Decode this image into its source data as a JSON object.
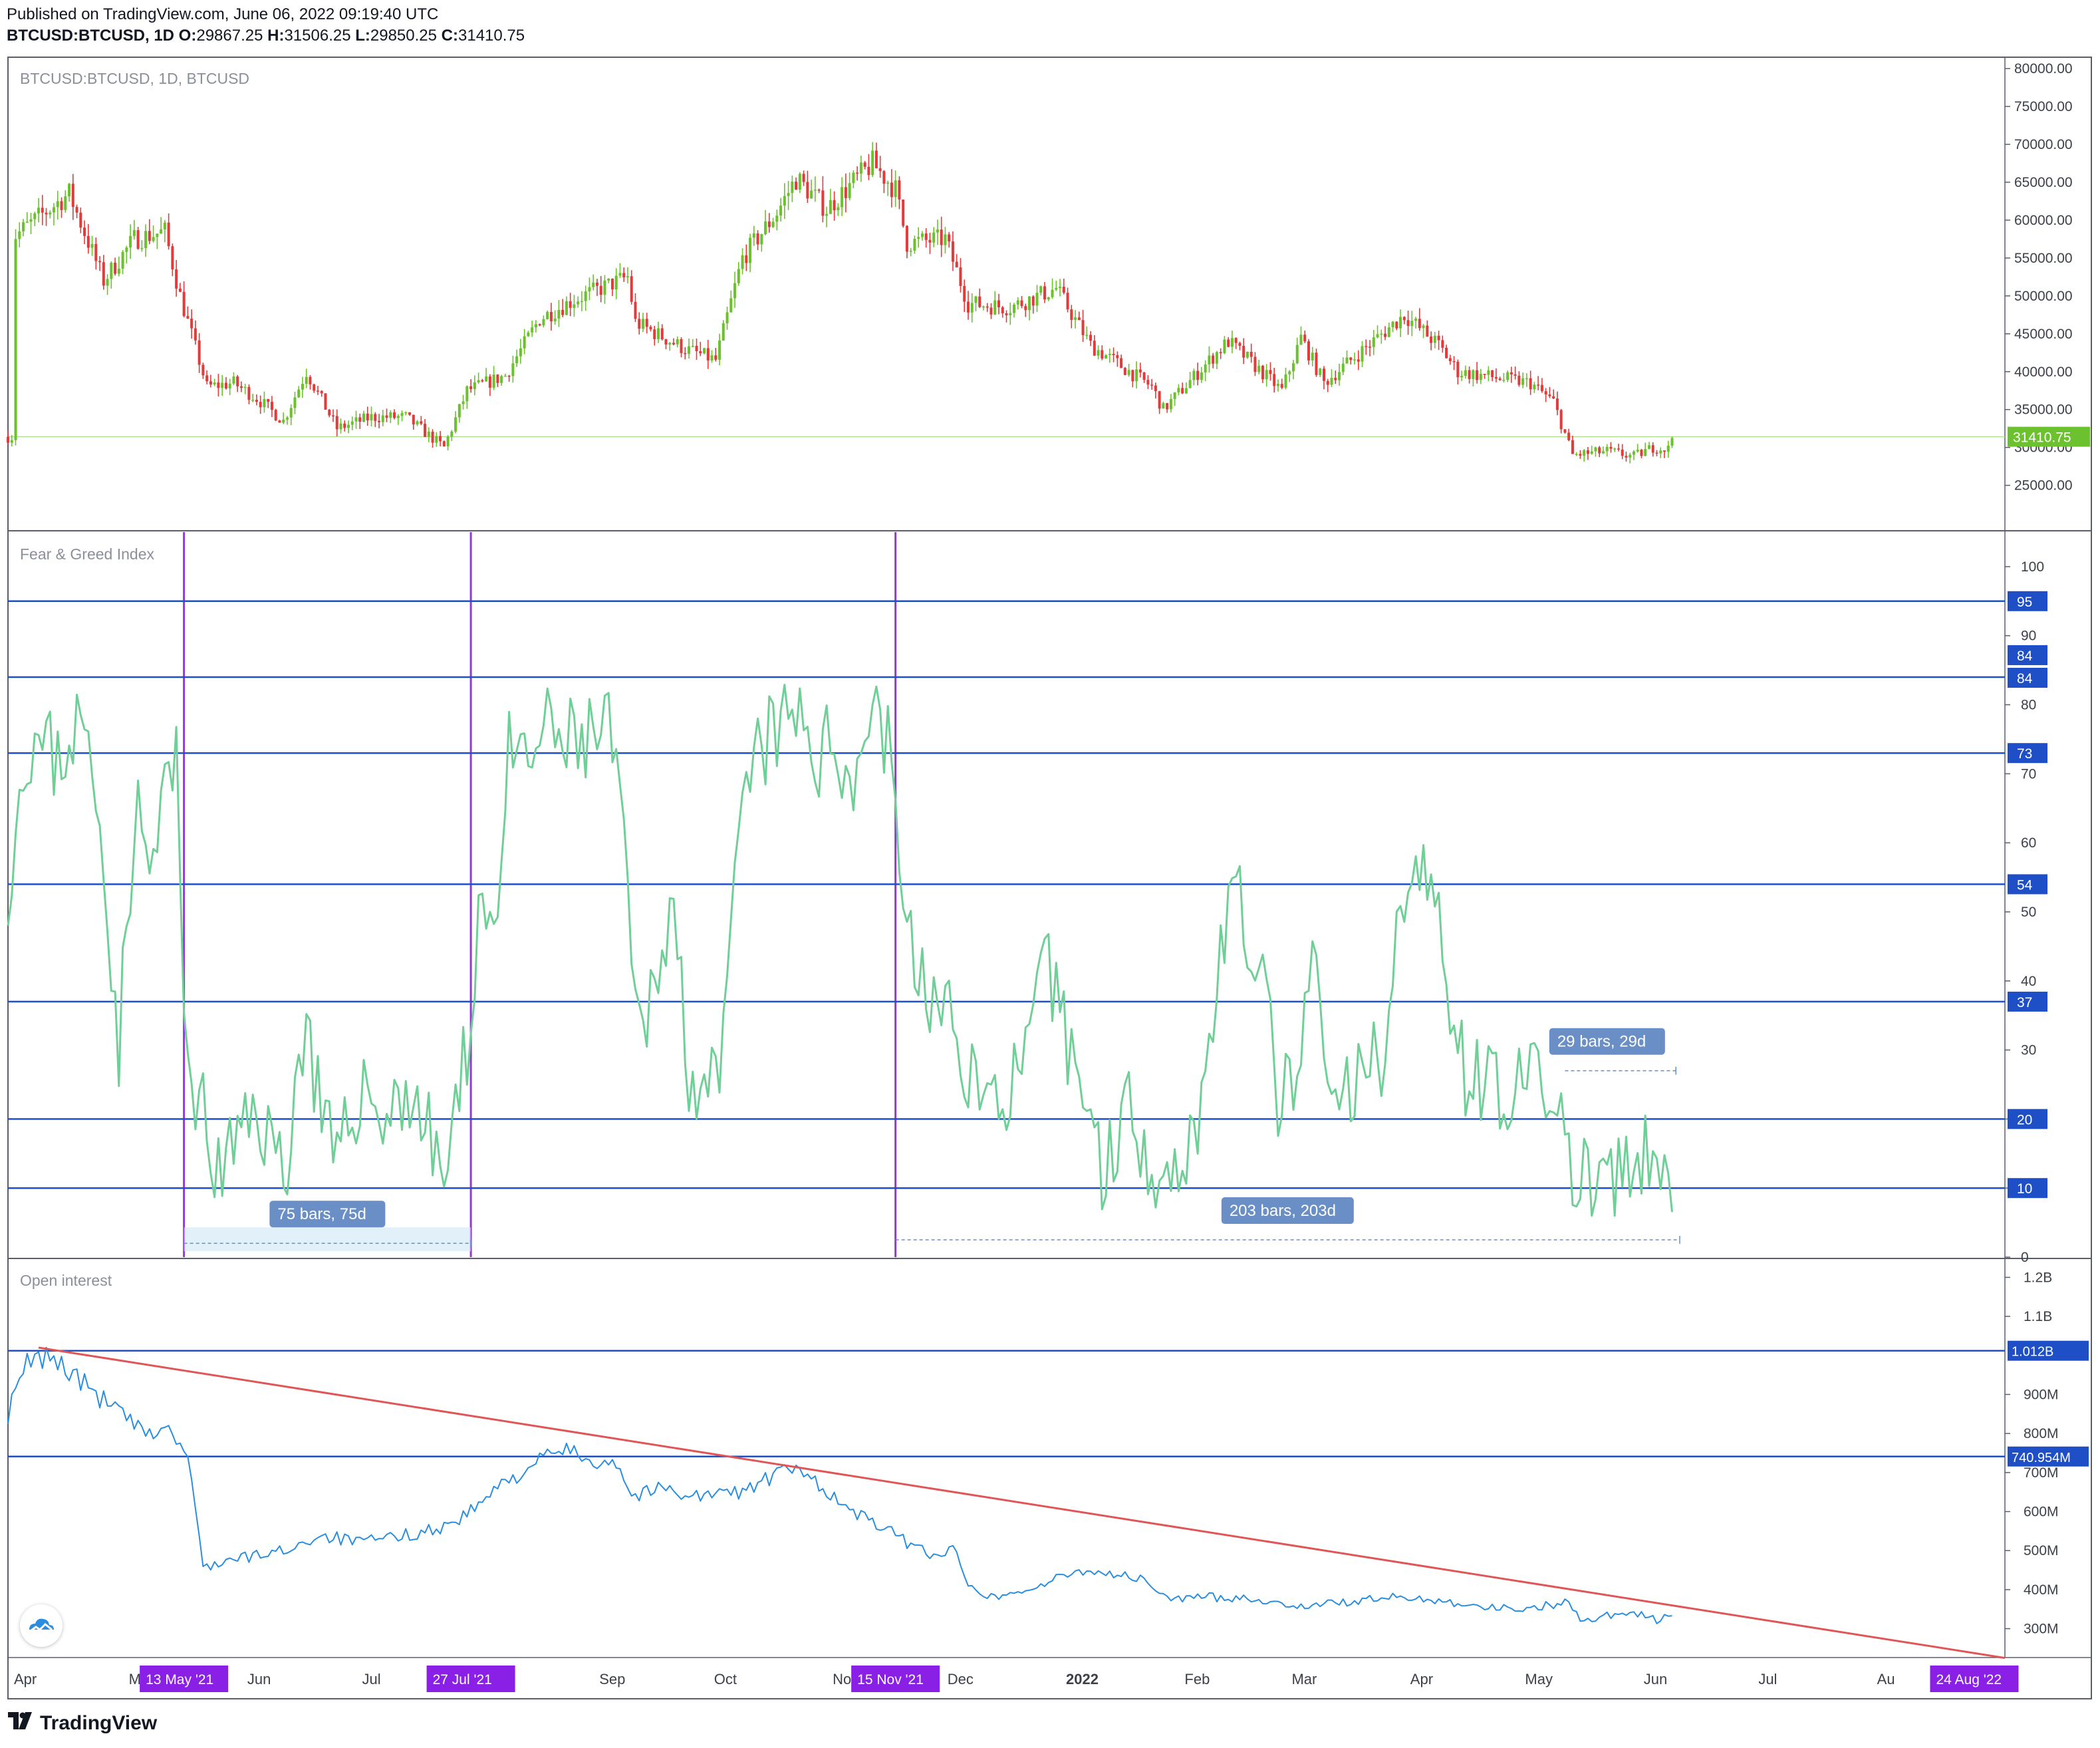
{
  "header": {
    "published": "Published on TradingView.com, June 06, 2022 09:19:40 UTC",
    "symbol": "BTCUSD:BTCUSD, 1D",
    "o_label": "O:",
    "o_value": "29867.25",
    "h_label": "H:",
    "h_value": "31506.25",
    "l_label": "L:",
    "l_value": "29850.25",
    "c_label": "C:",
    "c_value": "31410.75"
  },
  "brand": {
    "name": "TradingView",
    "logo_icon": "tradingview-logo-icon"
  },
  "colors": {
    "up": "#6cc22e",
    "down": "#e03c3c",
    "fng_line": "#6fcf97",
    "oi_line": "#2a8ee0",
    "hline": "#1e4fc7",
    "vline": "#9b30e8",
    "trend": "#e05555",
    "price_label_bg": "#6cc22e",
    "level_label_bg": "#1e4fc7",
    "date_label_bg": "#8a1fe6",
    "measure_label_bg": "#6a8fc7"
  },
  "chart_data": [
    {
      "type": "candlestick",
      "title": "BTCUSD:BTCUSD, 1D, BTCUSD",
      "x_range": [
        "2021-03-28",
        "2022-09-01"
      ],
      "ylim": [
        19000,
        81500
      ],
      "y_ticks": [
        "25000.00",
        "30000.00",
        "35000.00",
        "40000.00",
        "45000.00",
        "50000.00",
        "55000.00",
        "60000.00",
        "65000.00",
        "70000.00",
        "75000.00",
        "80000.00"
      ],
      "last_price": {
        "label": "31410.75",
        "value": 31410.75
      },
      "close_anchors": [
        [
          "2021-03-30",
          58000
        ],
        [
          "2021-04-13",
          63500
        ],
        [
          "2021-04-22",
          52000
        ],
        [
          "2021-04-30",
          57500
        ],
        [
          "2021-05-08",
          58500
        ],
        [
          "2021-05-12",
          50000
        ],
        [
          "2021-05-19",
          38000
        ],
        [
          "2021-05-26",
          38500
        ],
        [
          "2021-06-01",
          36500
        ],
        [
          "2021-06-08",
          33500
        ],
        [
          "2021-06-14",
          40000
        ],
        [
          "2021-06-22",
          32500
        ],
        [
          "2021-07-01",
          34000
        ],
        [
          "2021-07-10",
          34000
        ],
        [
          "2021-07-20",
          30000
        ],
        [
          "2021-07-26",
          37500
        ],
        [
          "2021-08-05",
          39500
        ],
        [
          "2021-08-14",
          47000
        ],
        [
          "2021-08-23",
          49500
        ],
        [
          "2021-09-06",
          52500
        ],
        [
          "2021-09-08",
          46500
        ],
        [
          "2021-09-21",
          43000
        ],
        [
          "2021-09-29",
          41500
        ],
        [
          "2021-10-06",
          55000
        ],
        [
          "2021-10-15",
          61000
        ],
        [
          "2021-10-20",
          65500
        ],
        [
          "2021-10-28",
          61500
        ],
        [
          "2021-11-09",
          67500
        ],
        [
          "2021-11-15",
          64000
        ],
        [
          "2021-11-18",
          57000
        ],
        [
          "2021-11-28",
          57500
        ],
        [
          "2021-12-04",
          49000
        ],
        [
          "2021-12-15",
          48500
        ],
        [
          "2021-12-27",
          51000
        ],
        [
          "2022-01-05",
          43500
        ],
        [
          "2022-01-21",
          38000
        ],
        [
          "2022-01-24",
          35000
        ],
        [
          "2022-02-06",
          42000
        ],
        [
          "2022-02-10",
          44000
        ],
        [
          "2022-02-24",
          37500
        ],
        [
          "2022-03-01",
          44500
        ],
        [
          "2022-03-07",
          38500
        ],
        [
          "2022-03-28",
          47500
        ],
        [
          "2022-04-06",
          43500
        ],
        [
          "2022-04-11",
          40000
        ],
        [
          "2022-04-30",
          38500
        ],
        [
          "2022-05-06",
          36000
        ],
        [
          "2022-05-11",
          29000
        ],
        [
          "2022-05-20",
          29500
        ],
        [
          "2022-05-27",
          28800
        ],
        [
          "2022-06-01",
          30000
        ],
        [
          "2022-06-05",
          29800
        ],
        [
          "2022-06-06",
          31410.75
        ]
      ]
    },
    {
      "type": "line",
      "title": "Fear & Greed Index",
      "ylim": [
        0,
        105
      ],
      "y_ticks": [
        0,
        10,
        20,
        30,
        40,
        50,
        60,
        70,
        80,
        90,
        100
      ],
      "levels": [
        95,
        84,
        84,
        73,
        54,
        37,
        20,
        10
      ],
      "anchors": [
        [
          "2021-03-28",
          55
        ],
        [
          "2021-04-02",
          75
        ],
        [
          "2021-04-10",
          72
        ],
        [
          "2021-04-16",
          78
        ],
        [
          "2021-04-22",
          60
        ],
        [
          "2021-04-26",
          30
        ],
        [
          "2021-04-30",
          65
        ],
        [
          "2021-05-05",
          55
        ],
        [
          "2021-05-08",
          70
        ],
        [
          "2021-05-11",
          70
        ],
        [
          "2021-05-13",
          35
        ],
        [
          "2021-05-16",
          25
        ],
        [
          "2021-05-21",
          12
        ],
        [
          "2021-05-26",
          15
        ],
        [
          "2021-06-01",
          22
        ],
        [
          "2021-06-08",
          12
        ],
        [
          "2021-06-14",
          35
        ],
        [
          "2021-06-18",
          20
        ],
        [
          "2021-06-22",
          12
        ],
        [
          "2021-06-28",
          25
        ],
        [
          "2021-07-05",
          20
        ],
        [
          "2021-07-10",
          25
        ],
        [
          "2021-07-20",
          12
        ],
        [
          "2021-07-24",
          22
        ],
        [
          "2021-07-27",
          35
        ],
        [
          "2021-07-29",
          52
        ],
        [
          "2021-08-02",
          48
        ],
        [
          "2021-08-06",
          72
        ],
        [
          "2021-08-10",
          70
        ],
        [
          "2021-08-15",
          76
        ],
        [
          "2021-08-22",
          74
        ],
        [
          "2021-08-30",
          76
        ],
        [
          "2021-09-03",
          74
        ],
        [
          "2021-09-07",
          40
        ],
        [
          "2021-09-10",
          30
        ],
        [
          "2021-09-14",
          45
        ],
        [
          "2021-09-18",
          50
        ],
        [
          "2021-09-22",
          28
        ],
        [
          "2021-09-26",
          25
        ],
        [
          "2021-09-30",
          22
        ],
        [
          "2021-10-05",
          60
        ],
        [
          "2021-10-09",
          72
        ],
        [
          "2021-10-15",
          76
        ],
        [
          "2021-10-22",
          78
        ],
        [
          "2021-10-26",
          72
        ],
        [
          "2021-10-30",
          74
        ],
        [
          "2021-11-05",
          70
        ],
        [
          "2021-11-09",
          82
        ],
        [
          "2021-11-12",
          76
        ],
        [
          "2021-11-14",
          72
        ],
        [
          "2021-11-16",
          60
        ],
        [
          "2021-11-18",
          45
        ],
        [
          "2021-11-22",
          40
        ],
        [
          "2021-11-27",
          35
        ],
        [
          "2021-12-03",
          30
        ],
        [
          "2021-12-08",
          22
        ],
        [
          "2021-12-15",
          25
        ],
        [
          "2021-12-20",
          28
        ],
        [
          "2021-12-24",
          42
        ],
        [
          "2021-12-28",
          35
        ],
        [
          "2022-01-03",
          25
        ],
        [
          "2022-01-08",
          12
        ],
        [
          "2022-01-14",
          22
        ],
        [
          "2022-01-22",
          14
        ],
        [
          "2022-01-27",
          12
        ],
        [
          "2022-02-03",
          22
        ],
        [
          "2022-02-08",
          45
        ],
        [
          "2022-02-11",
          52
        ],
        [
          "2022-02-17",
          45
        ],
        [
          "2022-02-23",
          24
        ],
        [
          "2022-02-28",
          22
        ],
        [
          "2022-03-04",
          45
        ],
        [
          "2022-03-08",
          22
        ],
        [
          "2022-03-15",
          24
        ],
        [
          "2022-03-22",
          30
        ],
        [
          "2022-03-29",
          58
        ],
        [
          "2022-04-03",
          52
        ],
        [
          "2022-04-06",
          50
        ],
        [
          "2022-04-10",
          35
        ],
        [
          "2022-04-14",
          25
        ],
        [
          "2022-04-20",
          26
        ],
        [
          "2022-04-28",
          24
        ],
        [
          "2022-05-04",
          25
        ],
        [
          "2022-05-08",
          20
        ],
        [
          "2022-05-10",
          14
        ],
        [
          "2022-05-13",
          10
        ],
        [
          "2022-05-18",
          12
        ],
        [
          "2022-05-24",
          10
        ],
        [
          "2022-05-28",
          14
        ],
        [
          "2022-06-01",
          13
        ],
        [
          "2022-06-04",
          12
        ],
        [
          "2022-06-06",
          13
        ]
      ],
      "markers": [
        {
          "start": "2021-05-13",
          "end": "2021-07-27",
          "label": "75 bars, 75d",
          "at_value": 2
        },
        {
          "start": "2021-11-15",
          "end": "2022-06-08",
          "label": "203 bars, 203d",
          "at_value": 2.5
        },
        {
          "start": "2022-05-09",
          "end": "2022-06-07",
          "label": "29 bars, 29d",
          "at_value": 27
        }
      ]
    },
    {
      "type": "line",
      "title": "Open interest",
      "ylim": [
        226,
        1245
      ],
      "y_ticks": [
        "300M",
        "400M",
        "500M",
        "600M",
        "700M",
        "800M",
        "900M",
        "1.1B",
        "1.2B"
      ],
      "levels": [
        {
          "label": "1.012B",
          "value": 1012
        },
        {
          "label": "740.954M",
          "value": 741
        }
      ],
      "anchors": [
        [
          "2021-03-28",
          850
        ],
        [
          "2021-04-02",
          980
        ],
        [
          "2021-04-08",
          1000
        ],
        [
          "2021-04-13",
          960
        ],
        [
          "2021-04-20",
          900
        ],
        [
          "2021-04-28",
          840
        ],
        [
          "2021-05-03",
          790
        ],
        [
          "2021-05-08",
          820
        ],
        [
          "2021-05-12",
          770
        ],
        [
          "2021-05-14",
          740
        ],
        [
          "2021-05-18",
          460
        ],
        [
          "2021-05-28",
          480
        ],
        [
          "2021-06-08",
          500
        ],
        [
          "2021-06-18",
          540
        ],
        [
          "2021-06-28",
          520
        ],
        [
          "2021-07-10",
          540
        ],
        [
          "2021-07-20",
          560
        ],
        [
          "2021-07-27",
          600
        ],
        [
          "2021-08-03",
          660
        ],
        [
          "2021-08-12",
          720
        ],
        [
          "2021-08-20",
          760
        ],
        [
          "2021-08-28",
          730
        ],
        [
          "2021-09-03",
          730
        ],
        [
          "2021-09-07",
          640
        ],
        [
          "2021-09-15",
          660
        ],
        [
          "2021-09-25",
          640
        ],
        [
          "2021-10-05",
          650
        ],
        [
          "2021-10-12",
          680
        ],
        [
          "2021-10-18",
          710
        ],
        [
          "2021-10-25",
          680
        ],
        [
          "2021-11-03",
          600
        ],
        [
          "2021-11-10",
          570
        ],
        [
          "2021-11-18",
          520
        ],
        [
          "2021-11-25",
          490
        ],
        [
          "2021-12-01",
          500
        ],
        [
          "2021-12-04",
          420
        ],
        [
          "2021-12-10",
          380
        ],
        [
          "2021-12-20",
          400
        ],
        [
          "2021-12-28",
          430
        ],
        [
          "2022-01-03",
          450
        ],
        [
          "2022-01-12",
          440
        ],
        [
          "2022-01-20",
          420
        ],
        [
          "2022-01-24",
          380
        ],
        [
          "2022-02-05",
          380
        ],
        [
          "2022-02-15",
          380
        ],
        [
          "2022-02-25",
          360
        ],
        [
          "2022-03-05",
          360
        ],
        [
          "2022-03-15",
          370
        ],
        [
          "2022-03-25",
          380
        ],
        [
          "2022-04-05",
          375
        ],
        [
          "2022-04-15",
          360
        ],
        [
          "2022-04-25",
          350
        ],
        [
          "2022-05-05",
          360
        ],
        [
          "2022-05-10",
          370
        ],
        [
          "2022-05-13",
          320
        ],
        [
          "2022-05-20",
          335
        ],
        [
          "2022-05-28",
          340
        ],
        [
          "2022-06-02",
          320
        ],
        [
          "2022-06-06",
          340
        ]
      ],
      "trendline": {
        "from": [
          "2021-04-05",
          1020
        ],
        "to": [
          "2022-09-01",
          225
        ]
      }
    }
  ],
  "x_axis": {
    "labels": [
      {
        "text": "Apr",
        "date": "2021-04-01"
      },
      {
        "text": "Ma",
        "date": "2021-05-01"
      },
      {
        "text": "Jun",
        "date": "2021-06-01"
      },
      {
        "text": "Jul",
        "date": "2021-07-01"
      },
      {
        "text": "Sep",
        "date": "2021-09-01"
      },
      {
        "text": "Oct",
        "date": "2021-10-01"
      },
      {
        "text": "Nov",
        "date": "2021-11-01"
      },
      {
        "text": "Dec",
        "date": "2021-12-01"
      },
      {
        "text": "2022",
        "date": "2022-01-01",
        "bold": true
      },
      {
        "text": "Feb",
        "date": "2022-02-01"
      },
      {
        "text": "Mar",
        "date": "2022-03-01"
      },
      {
        "text": "Apr",
        "date": "2022-04-01"
      },
      {
        "text": "May",
        "date": "2022-05-01"
      },
      {
        "text": "Jun",
        "date": "2022-06-01"
      },
      {
        "text": "Jul",
        "date": "2022-07-01"
      },
      {
        "text": "Au",
        "date": "2022-08-01"
      }
    ],
    "marked_dates": [
      {
        "label": "13 May '21",
        "date": "2021-05-13"
      },
      {
        "label": "27 Jul '21",
        "date": "2021-07-27"
      },
      {
        "label": "15 Nov '21",
        "date": "2021-11-15"
      },
      {
        "label": "24 Aug '22",
        "date": "2022-08-24"
      }
    ]
  }
}
